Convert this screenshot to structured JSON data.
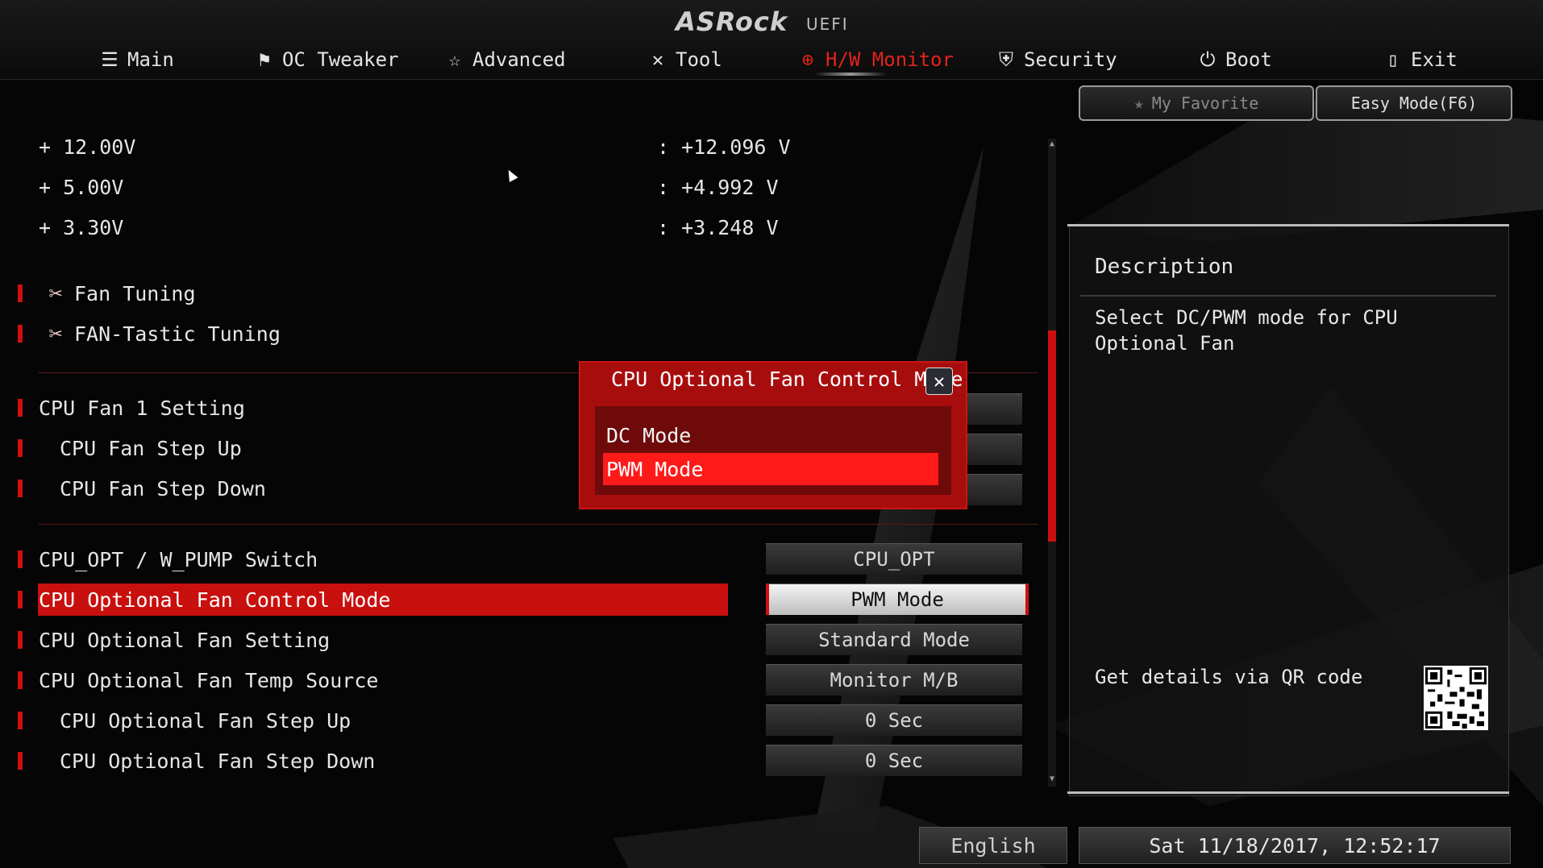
{
  "header": {
    "brand": "ASRock",
    "subtitle": "UEFI"
  },
  "nav": {
    "main": "Main",
    "oc_tweaker": "OC Tweaker",
    "advanced": "Advanced",
    "tool": "Tool",
    "hw_monitor": "H/W Monitor",
    "security": "Security",
    "boot": "Boot",
    "exit": "Exit",
    "active_color": "#e2231a"
  },
  "buttons": {
    "my_favorite": "My Favorite",
    "easy_mode": "Easy Mode(F6)"
  },
  "voltages": [
    {
      "label": "+ 12.00V",
      "value": ": +12.096 V"
    },
    {
      "label": "+ 5.00V",
      "value": ": +4.992 V"
    },
    {
      "label": "+ 3.30V",
      "value": ": +3.248 V"
    }
  ],
  "tools": {
    "fan_tuning": "Fan Tuning",
    "fan_tastic": "FAN-Tastic Tuning"
  },
  "cpu_fan": {
    "setting": "CPU Fan 1 Setting",
    "step_up": "CPU Fan Step Up",
    "step_down": "CPU Fan Step Down"
  },
  "options": [
    {
      "label": "CPU_OPT / W_PUMP Switch",
      "value": "CPU_OPT"
    },
    {
      "label": "CPU Optional Fan Control Mode",
      "value": "PWM Mode"
    },
    {
      "label": "CPU Optional Fan Setting",
      "value": "Standard Mode"
    },
    {
      "label": "CPU Optional Fan Temp Source",
      "value": "Monitor M/B"
    },
    {
      "label": "CPU Optional Fan Step Up",
      "value": "0 Sec"
    },
    {
      "label": "CPU Optional Fan Step Down",
      "value": "0 Sec"
    }
  ],
  "popup": {
    "title": "CPU Optional Fan Control Mode",
    "options": [
      "DC Mode",
      "PWM Mode"
    ],
    "selected": "PWM Mode"
  },
  "description": {
    "title": "Description",
    "text": "Select DC/PWM mode for CPU Optional Fan",
    "qr_label": "Get details via QR code"
  },
  "footer": {
    "language": "English",
    "datetime": "Sat 11/18/2017, 12:52:17"
  },
  "colors": {
    "accent_red": "#c8100f",
    "highlight_red": "#ff1a1a"
  }
}
